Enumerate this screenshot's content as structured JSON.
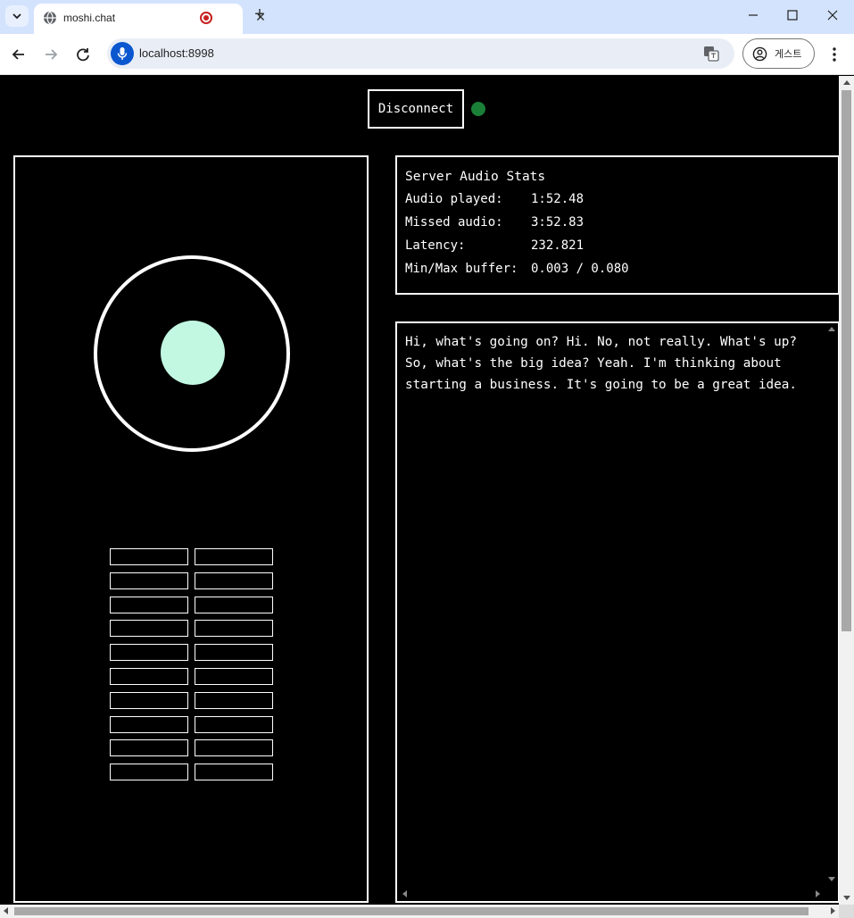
{
  "browser": {
    "tab_title": "moshi.chat",
    "url": "localhost:8998",
    "profile_label": "게스트",
    "icons": {
      "tab_menu": "chevron-down-icon",
      "favicon": "globe-icon",
      "recording": "recording-icon",
      "close_tab": "close-icon",
      "new_tab": "plus-icon",
      "minimize": "minimize-icon",
      "maximize": "maximize-icon",
      "close_window": "close-icon",
      "back": "back-arrow-icon",
      "forward": "forward-arrow-icon",
      "reload": "reload-icon",
      "mic": "mic-icon",
      "translate": "translate-icon",
      "profile": "profile-icon",
      "menu": "kebab-menu-icon"
    },
    "new_tab_glyph": "+",
    "close_glyph": "✕"
  },
  "app": {
    "disconnect_label": "Disconnect",
    "status_color": "#1a7f37",
    "stats": {
      "title": "Server Audio Stats",
      "rows": [
        {
          "label": "Audio played:",
          "value": "1:52.48"
        },
        {
          "label": "Missed audio:",
          "value": "3:52.83"
        },
        {
          "label": "Latency:",
          "value": "232.821"
        },
        {
          "label": "Min/Max buffer:",
          "value": "0.003 / 0.080"
        }
      ]
    },
    "transcript": "Hi, what's going on? Hi. No, not really. What's up?\nSo, what's the big idea? Yeah. I'm thinking about\nstarting a business. It's going to be a great idea.",
    "visualizer": {
      "ring_color": "#ffffff",
      "dot_color": "#c2f8e2",
      "meter_columns": 2,
      "meter_rows": 10
    }
  }
}
